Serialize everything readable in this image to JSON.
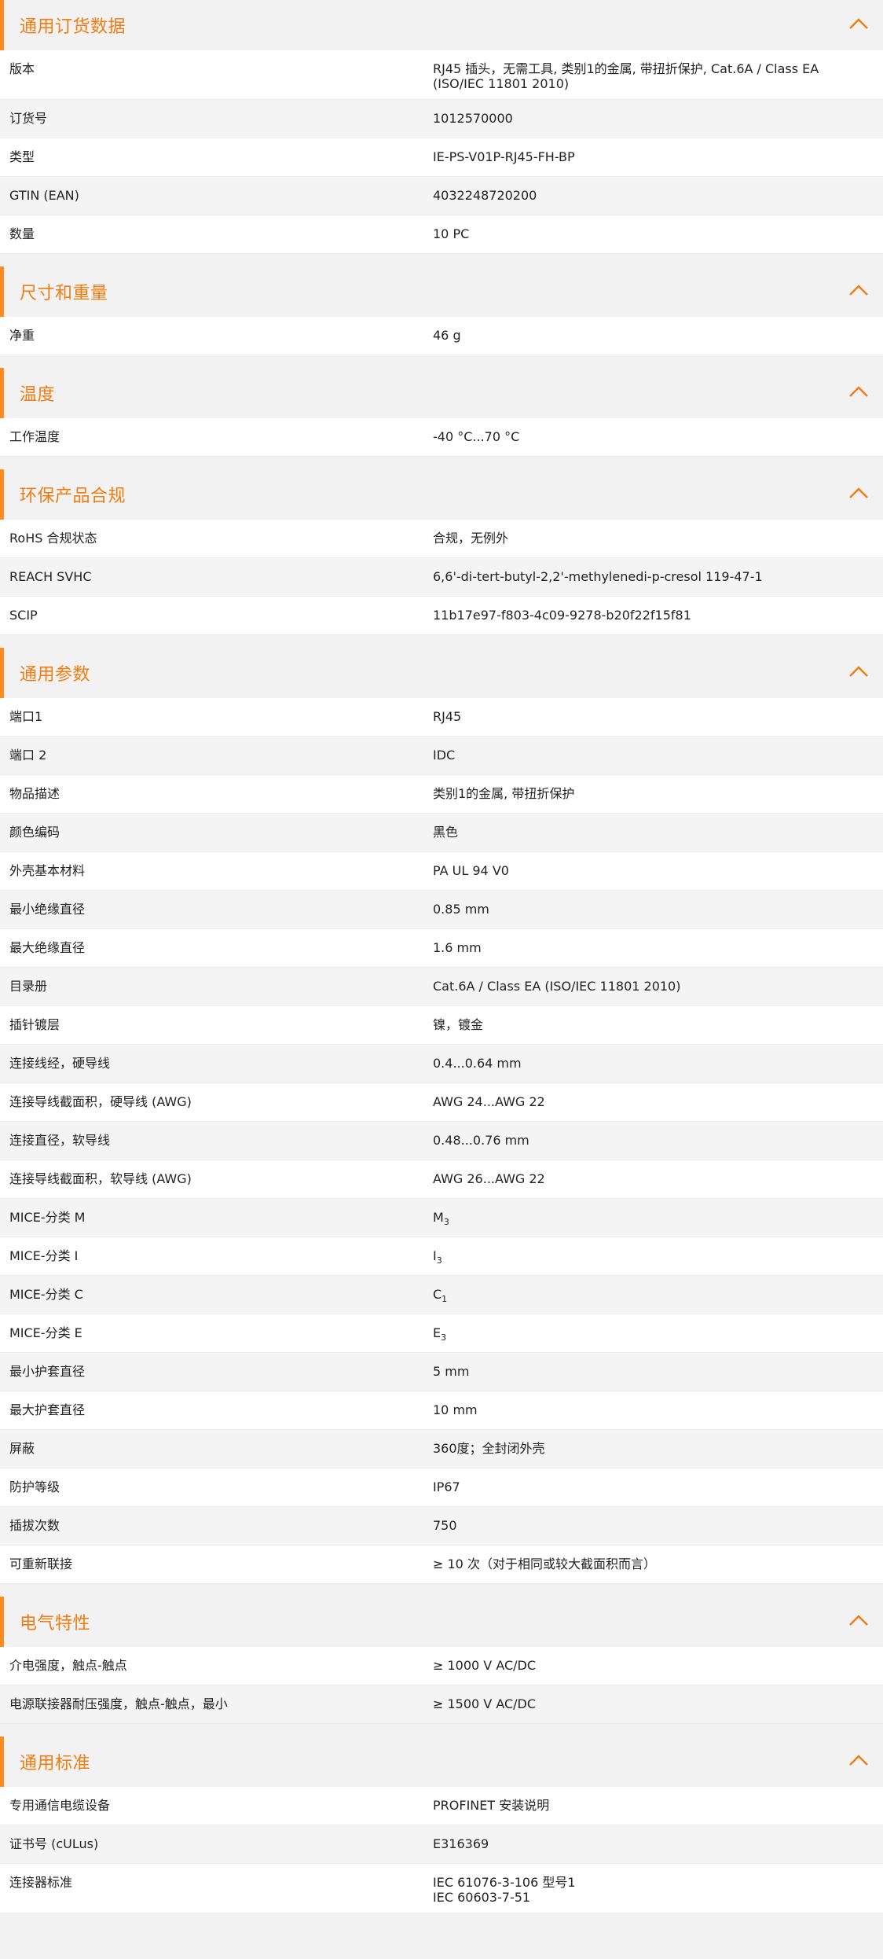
{
  "sections": [
    {
      "title": "通用订货数据",
      "rows": [
        {
          "label": "版本",
          "value": "RJ45 插头，无需工具, 类别1的金属, 带扭折保护, Cat.6A / Class EA (ISO/IEC 11801 2010)"
        },
        {
          "label": "订货号",
          "value": "1012570000"
        },
        {
          "label": "类型",
          "value": "IE-PS-V01P-RJ45-FH-BP"
        },
        {
          "label": "GTIN (EAN)",
          "value": "4032248720200"
        },
        {
          "label": "数量",
          "value": "10  PC"
        }
      ]
    },
    {
      "title": "尺寸和重量",
      "rows": [
        {
          "label": "净重",
          "value": "46  g"
        }
      ]
    },
    {
      "title": "温度",
      "rows": [
        {
          "label": "工作温度",
          "value": "-40 °C...70 °C"
        }
      ]
    },
    {
      "title": "环保产品合规",
      "rows": [
        {
          "label": "RoHS 合规状态",
          "value": "合规，无例外"
        },
        {
          "label": "REACH SVHC",
          "value": "6,6'-di-tert-butyl-2,2'-methylenedi-p-cresol 119-47-1"
        },
        {
          "label": "SCIP",
          "value": "11b17e97-f803-4c09-9278-b20f22f15f81"
        }
      ]
    },
    {
      "title": "通用参数",
      "rows": [
        {
          "label": "端口1",
          "value": "RJ45"
        },
        {
          "label": "端口 2",
          "value": "IDC"
        },
        {
          "label": "物品描述",
          "value": "类别1的金属, 带扭折保护"
        },
        {
          "label": "颜色编码",
          "value": "黑色"
        },
        {
          "label": "外壳基本材料",
          "value": "PA UL 94 V0"
        },
        {
          "label": "最小绝缘直径",
          "value": "0.85  mm"
        },
        {
          "label": "最大绝缘直径",
          "value": "1.6  mm"
        },
        {
          "label": "目录册",
          "value": "Cat.6A / Class EA (ISO/IEC 11801 2010)"
        },
        {
          "label": "插针镀层",
          "value": "镍，镀金"
        },
        {
          "label": "连接线经，硬导线",
          "value": "0.4...0.64 mm"
        },
        {
          "label": "连接导线截面积，硬导线 (AWG)",
          "value": "AWG 24...AWG 22"
        },
        {
          "label": "连接直径，软导线",
          "value": "0.48...0.76 mm"
        },
        {
          "label": "连接导线截面积，软导线 (AWG)",
          "value": "AWG 26...AWG 22"
        },
        {
          "label": "MICE-分类 M",
          "value": "M",
          "sub": "3"
        },
        {
          "label": "MICE-分类 I",
          "value": "I",
          "sub": "3"
        },
        {
          "label": "MICE-分类 C",
          "value": "C",
          "sub": "1"
        },
        {
          "label": "MICE-分类 E",
          "value": "E",
          "sub": "3"
        },
        {
          "label": "最小护套直径",
          "value": "5  mm"
        },
        {
          "label": "最大护套直径",
          "value": "10  mm"
        },
        {
          "label": "屏蔽",
          "value": "360度；全封闭外壳"
        },
        {
          "label": "防护等级",
          "value": "IP67"
        },
        {
          "label": "插拔次数",
          "value": "750"
        },
        {
          "label": "可重新联接",
          "value": "≥ 10 次（对于相同或较大截面积而言）"
        }
      ]
    },
    {
      "title": "电气特性",
      "rows": [
        {
          "label": "介电强度，触点-触点",
          "value": "≥ 1000 V AC/DC"
        },
        {
          "label": "电源联接器耐压强度，触点-触点，最小",
          "value": "≥ 1500 V AC/DC"
        }
      ]
    },
    {
      "title": "通用标准",
      "rows": [
        {
          "label": "专用通信电缆设备",
          "value": "PROFINET 安装说明"
        },
        {
          "label": "证书号 (cULus)",
          "value": "E316369"
        },
        {
          "label": "连接器标准",
          "value": "IEC 61076-3-106 型号1\nIEC 60603-7-51"
        }
      ]
    }
  ],
  "icons": {
    "collapse": "chevron-up-icon"
  },
  "colors": {
    "accent": "#ff8a1f",
    "title": "#f07c12",
    "header_bg": "#f2f2f2",
    "row_alt_bg": "#f4f4f4"
  }
}
